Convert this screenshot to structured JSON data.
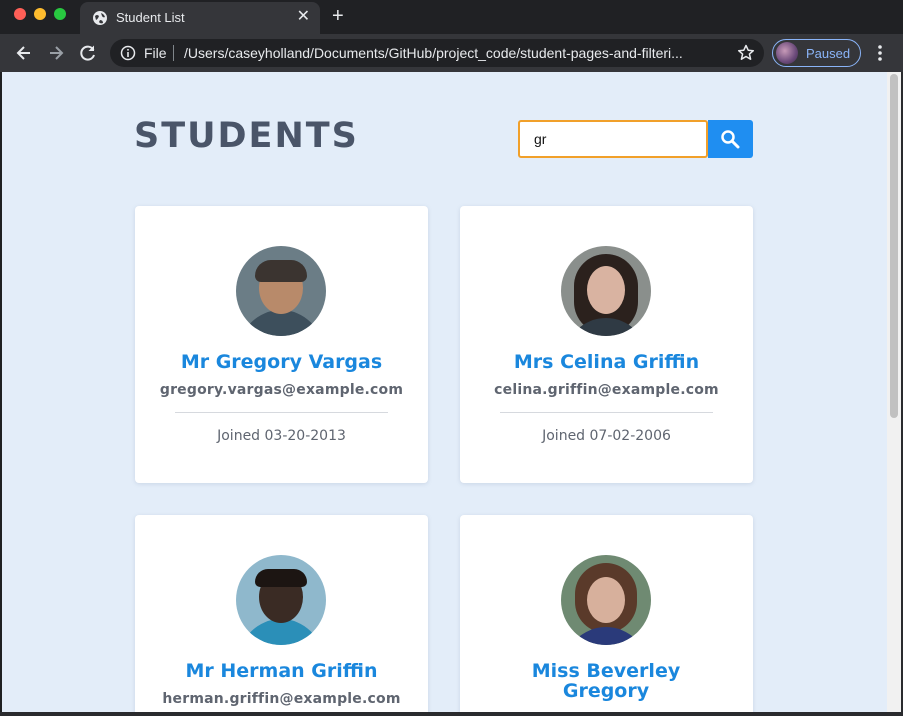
{
  "browser": {
    "tab_title": "Student List",
    "scheme_label": "File",
    "url": "/Users/caseyholland/Documents/GitHub/project_code/student-pages-and-filteri...",
    "profile_label": "Paused"
  },
  "page": {
    "heading": "STUDENTS",
    "search": {
      "value": "gr"
    },
    "students": [
      {
        "name": "Mr Gregory Vargas",
        "email": "gregory.vargas@example.com",
        "joined": "Joined 03-20-2013"
      },
      {
        "name": "Mrs Celina Griffin",
        "email": "celina.griffin@example.com",
        "joined": "Joined 07-02-2006"
      },
      {
        "name": "Mr Herman Griffin",
        "email": "herman.griffin@example.com"
      },
      {
        "name": "Miss Beverley Gregory"
      }
    ]
  },
  "colors": {
    "page_background": "#e3edf9",
    "accent": "#1a87dd",
    "search_focus_border": "#f1a02a",
    "search_button": "#1f8ef1"
  }
}
